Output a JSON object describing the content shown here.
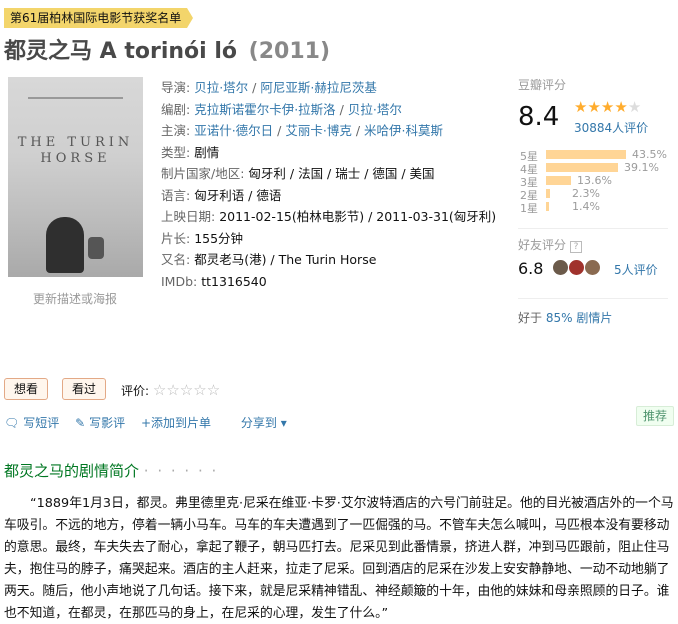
{
  "award": "第61届柏林国际电影节获奖名单",
  "title": {
    "name": "都灵之马 A torinói ló",
    "year": "(2011)"
  },
  "poster": {
    "title_text": "THE TURIN HORSE",
    "more_link": "更新描述或海报"
  },
  "info": {
    "director_label": "导演:",
    "directors": [
      "贝拉·塔尔",
      "阿尼亚斯·赫拉尼茨基"
    ],
    "writer_label": "编剧:",
    "writers": [
      "克拉斯诺霍尔卡伊·拉斯洛",
      "贝拉·塔尔"
    ],
    "cast_label": "主演:",
    "cast": [
      "亚诺什·德尔日",
      "艾丽卡·博克",
      "米哈伊·科莫斯"
    ],
    "genre_label": "类型:",
    "genre": "剧情",
    "country_label": "制片国家/地区:",
    "country": "匈牙利 / 法国 / 瑞士 / 德国 / 美国",
    "language_label": "语言:",
    "language": "匈牙利语 / 德语",
    "release_label": "上映日期:",
    "release": "2011-02-15(柏林电影节) / 2011-03-31(匈牙利)",
    "runtime_label": "片长:",
    "runtime": "155分钟",
    "aka_label": "又名:",
    "aka": "都灵老马(港) / The Turin Horse",
    "imdb_label": "IMDb:",
    "imdb": "tt1316540"
  },
  "rating": {
    "title": "豆瓣评分",
    "score": "8.4",
    "stars_filled": 4,
    "stars_total": 5,
    "count_text": "30884人评价",
    "distribution": [
      {
        "label": "5星",
        "percent": 43.5,
        "text": "43.5%"
      },
      {
        "label": "4星",
        "percent": 39.1,
        "text": "39.1%"
      },
      {
        "label": "3星",
        "percent": 13.6,
        "text": "13.6%"
      },
      {
        "label": "2星",
        "percent": 2.3,
        "text": "2.3%"
      },
      {
        "label": "1星",
        "percent": 1.4,
        "text": "1.4%"
      }
    ],
    "friend_title": "好友评分",
    "friend_help": "?",
    "friend_score": "6.8",
    "friend_count": "5人评价",
    "better_prefix": "好于",
    "better_link": "85% 剧情片"
  },
  "actions": {
    "want": "想看",
    "seen": "看过",
    "rate_label": "评价:",
    "write_short": "写短评",
    "write_review": "写影评",
    "add_list": "+添加到片单",
    "share": "分享到",
    "recommend": "推荐"
  },
  "synopsis": {
    "heading": "都灵之马的剧情简介",
    "dots": "· · · · · ·",
    "text": "“1889年1月3日，都灵。弗里德里克·尼采在维亚·卡罗·艾尔波特酒店的六号门前驻足。他的目光被酒店外的一个马车吸引。不远的地方，停着一辆小马车。马车的车夫遭遇到了一匹倔强的马。不管车夫怎么喊叫，马匹根本没有要移动的意思。最终，车夫失去了耐心，拿起了鞭子，朝马匹打去。尼采见到此番情景，挤进人群，冲到马匹跟前，阻止住马夫，抱住马的脖子，痛哭起来。酒店的主人赶来，拉走了尼采。回到酒店的尼采在沙发上安安静静地、一动不动地躺了两天。随后，他小声地说了几句话。接下来，就是尼采精神错乱、神经颠簸的十年，由他的妹妹和母亲照顾的日子。谁也不知道，在都灵，在那匹马的身上，在尼采的心理，发生了什么。”"
  },
  "colors": {
    "link": "#3377aa",
    "star": "#ffac2d",
    "bar": "#ffd596",
    "award_bg": "#f3d56b",
    "section_heading": "#007722"
  }
}
